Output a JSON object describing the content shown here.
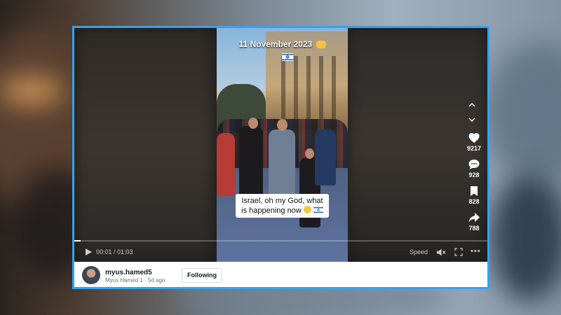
{
  "video": {
    "date_overlay": "11 November 2023",
    "caption_line1": "Israel, oh my God, what",
    "caption_line2": "is happening now"
  },
  "actions": [
    {
      "icon": "heart-icon",
      "count": "9217"
    },
    {
      "icon": "comment-icon",
      "count": "928"
    },
    {
      "icon": "bookmark-icon",
      "count": "828"
    },
    {
      "icon": "share-icon",
      "count": "788"
    }
  ],
  "controls": {
    "time": "00:01 / 01:03",
    "speed_label": "Speed",
    "progress": 0.016
  },
  "author": {
    "username": "myus.hamed5",
    "subline": "Myus Hamed 1 · 5d ago",
    "follow_label": "Following"
  },
  "colors": {
    "frame_border": "#3aa0e8",
    "video_bg": "#1b1a19"
  }
}
